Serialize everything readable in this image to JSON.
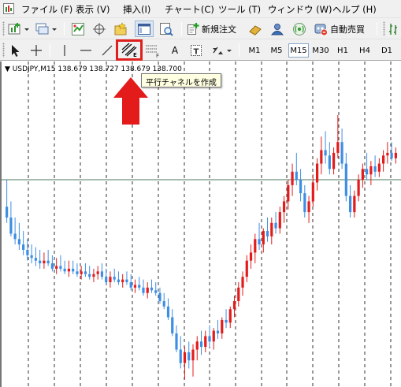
{
  "menu": {
    "items": [
      "ファイル (F)",
      "表示 (V)",
      "挿入(I)",
      "チャート(C)",
      "ツール (T)",
      "ウィンドウ (W)",
      "ヘルプ (H)"
    ]
  },
  "toolbar": {
    "new_order_label": "新規注文",
    "auto_trading_label": "自動売買"
  },
  "drawing_tools": {
    "text_label": "A",
    "text_label_tool": "T",
    "channel_tool_letter": "E",
    "fibo_letter": "F"
  },
  "timeframes": [
    "M1",
    "M5",
    "M15",
    "M30",
    "H1",
    "H4",
    "D1"
  ],
  "active_timeframe": "M15",
  "chart": {
    "header": "USDJPY,M15  138.679 138.727 138.679 138.700",
    "tooltip": "平行チャネルを作成"
  },
  "colors": {
    "bull": "#e31b1b",
    "bear": "#3e8ee3",
    "arrow": "#e31b1b",
    "grid": "#000000",
    "horizontal_line": "#4a7a5c"
  },
  "chart_data": {
    "type": "candlestick",
    "symbol": "USDJPY",
    "timeframe": "M15",
    "header_values": [
      138.679,
      138.727,
      138.679,
      138.7
    ],
    "note": "Relative price path in relative units (0 = lowest low, 100 = highest high); no price axis is visible.",
    "candles": [
      {
        "o": 66,
        "h": 76,
        "l": 60,
        "c": 62
      },
      {
        "o": 62,
        "h": 68,
        "l": 55,
        "c": 56
      },
      {
        "o": 56,
        "h": 62,
        "l": 52,
        "c": 54
      },
      {
        "o": 54,
        "h": 60,
        "l": 50,
        "c": 52
      },
      {
        "o": 52,
        "h": 57,
        "l": 48,
        "c": 50
      },
      {
        "o": 50,
        "h": 54,
        "l": 46,
        "c": 48
      },
      {
        "o": 48,
        "h": 52,
        "l": 45,
        "c": 47
      },
      {
        "o": 47,
        "h": 51,
        "l": 44,
        "c": 46
      },
      {
        "o": 46,
        "h": 50,
        "l": 43,
        "c": 45
      },
      {
        "o": 45,
        "h": 49,
        "l": 43,
        "c": 46
      },
      {
        "o": 46,
        "h": 50,
        "l": 44,
        "c": 45
      },
      {
        "o": 45,
        "h": 48,
        "l": 42,
        "c": 43
      },
      {
        "o": 43,
        "h": 47,
        "l": 41,
        "c": 44
      },
      {
        "o": 44,
        "h": 48,
        "l": 42,
        "c": 43
      },
      {
        "o": 43,
        "h": 46,
        "l": 41,
        "c": 42
      },
      {
        "o": 42,
        "h": 46,
        "l": 40,
        "c": 43
      },
      {
        "o": 43,
        "h": 46,
        "l": 41,
        "c": 42
      },
      {
        "o": 42,
        "h": 45,
        "l": 40,
        "c": 41
      },
      {
        "o": 41,
        "h": 44,
        "l": 39,
        "c": 42
      },
      {
        "o": 42,
        "h": 45,
        "l": 40,
        "c": 41
      },
      {
        "o": 41,
        "h": 44,
        "l": 39,
        "c": 40
      },
      {
        "o": 40,
        "h": 43,
        "l": 38,
        "c": 41
      },
      {
        "o": 41,
        "h": 44,
        "l": 39,
        "c": 42
      },
      {
        "o": 42,
        "h": 45,
        "l": 39,
        "c": 40
      },
      {
        "o": 40,
        "h": 43,
        "l": 37,
        "c": 38
      },
      {
        "o": 38,
        "h": 42,
        "l": 36,
        "c": 40
      },
      {
        "o": 40,
        "h": 43,
        "l": 38,
        "c": 39
      },
      {
        "o": 39,
        "h": 42,
        "l": 37,
        "c": 38
      },
      {
        "o": 38,
        "h": 41,
        "l": 36,
        "c": 39
      },
      {
        "o": 39,
        "h": 42,
        "l": 37,
        "c": 38
      },
      {
        "o": 38,
        "h": 41,
        "l": 35,
        "c": 36
      },
      {
        "o": 36,
        "h": 39,
        "l": 34,
        "c": 37
      },
      {
        "o": 37,
        "h": 40,
        "l": 35,
        "c": 36
      },
      {
        "o": 36,
        "h": 39,
        "l": 33,
        "c": 34
      },
      {
        "o": 34,
        "h": 38,
        "l": 32,
        "c": 36
      },
      {
        "o": 36,
        "h": 39,
        "l": 34,
        "c": 35
      },
      {
        "o": 35,
        "h": 38,
        "l": 33,
        "c": 34
      },
      {
        "o": 34,
        "h": 36,
        "l": 30,
        "c": 31
      },
      {
        "o": 31,
        "h": 34,
        "l": 28,
        "c": 29
      },
      {
        "o": 29,
        "h": 32,
        "l": 24,
        "c": 25
      },
      {
        "o": 25,
        "h": 28,
        "l": 18,
        "c": 19
      },
      {
        "o": 19,
        "h": 22,
        "l": 12,
        "c": 13
      },
      {
        "o": 13,
        "h": 18,
        "l": 6,
        "c": 8
      },
      {
        "o": 8,
        "h": 14,
        "l": 2,
        "c": 12
      },
      {
        "o": 12,
        "h": 16,
        "l": 6,
        "c": 9
      },
      {
        "o": 9,
        "h": 15,
        "l": 3,
        "c": 13
      },
      {
        "o": 13,
        "h": 18,
        "l": 9,
        "c": 16
      },
      {
        "o": 16,
        "h": 20,
        "l": 11,
        "c": 14
      },
      {
        "o": 14,
        "h": 20,
        "l": 12,
        "c": 18
      },
      {
        "o": 18,
        "h": 22,
        "l": 14,
        "c": 16
      },
      {
        "o": 16,
        "h": 21,
        "l": 13,
        "c": 20
      },
      {
        "o": 20,
        "h": 24,
        "l": 17,
        "c": 19
      },
      {
        "o": 19,
        "h": 25,
        "l": 17,
        "c": 24
      },
      {
        "o": 24,
        "h": 28,
        "l": 21,
        "c": 23
      },
      {
        "o": 23,
        "h": 29,
        "l": 21,
        "c": 28
      },
      {
        "o": 28,
        "h": 33,
        "l": 25,
        "c": 31
      },
      {
        "o": 31,
        "h": 38,
        "l": 29,
        "c": 36
      },
      {
        "o": 36,
        "h": 42,
        "l": 33,
        "c": 40
      },
      {
        "o": 40,
        "h": 48,
        "l": 38,
        "c": 46
      },
      {
        "o": 46,
        "h": 52,
        "l": 43,
        "c": 49
      },
      {
        "o": 49,
        "h": 56,
        "l": 45,
        "c": 54
      },
      {
        "o": 54,
        "h": 60,
        "l": 50,
        "c": 52
      },
      {
        "o": 52,
        "h": 58,
        "l": 49,
        "c": 57
      },
      {
        "o": 57,
        "h": 62,
        "l": 53,
        "c": 55
      },
      {
        "o": 55,
        "h": 62,
        "l": 52,
        "c": 60
      },
      {
        "o": 60,
        "h": 64,
        "l": 56,
        "c": 58
      },
      {
        "o": 58,
        "h": 66,
        "l": 56,
        "c": 64
      },
      {
        "o": 64,
        "h": 70,
        "l": 60,
        "c": 68
      },
      {
        "o": 68,
        "h": 76,
        "l": 65,
        "c": 74
      },
      {
        "o": 74,
        "h": 82,
        "l": 70,
        "c": 79
      },
      {
        "o": 79,
        "h": 86,
        "l": 74,
        "c": 76
      },
      {
        "o": 76,
        "h": 80,
        "l": 68,
        "c": 71
      },
      {
        "o": 71,
        "h": 74,
        "l": 62,
        "c": 64
      },
      {
        "o": 64,
        "h": 70,
        "l": 60,
        "c": 68
      },
      {
        "o": 68,
        "h": 78,
        "l": 66,
        "c": 75
      },
      {
        "o": 75,
        "h": 84,
        "l": 72,
        "c": 82
      },
      {
        "o": 82,
        "h": 92,
        "l": 78,
        "c": 87
      },
      {
        "o": 87,
        "h": 94,
        "l": 82,
        "c": 85
      },
      {
        "o": 85,
        "h": 90,
        "l": 78,
        "c": 80
      },
      {
        "o": 80,
        "h": 88,
        "l": 78,
        "c": 86
      },
      {
        "o": 86,
        "h": 100,
        "l": 84,
        "c": 90
      },
      {
        "o": 90,
        "h": 95,
        "l": 80,
        "c": 82
      },
      {
        "o": 82,
        "h": 86,
        "l": 68,
        "c": 70
      },
      {
        "o": 70,
        "h": 74,
        "l": 62,
        "c": 64
      },
      {
        "o": 64,
        "h": 72,
        "l": 62,
        "c": 70
      },
      {
        "o": 70,
        "h": 78,
        "l": 68,
        "c": 76
      },
      {
        "o": 76,
        "h": 82,
        "l": 73,
        "c": 80
      },
      {
        "o": 80,
        "h": 86,
        "l": 76,
        "c": 78
      },
      {
        "o": 78,
        "h": 83,
        "l": 74,
        "c": 81
      },
      {
        "o": 81,
        "h": 85,
        "l": 77,
        "c": 79
      },
      {
        "o": 79,
        "h": 84,
        "l": 77,
        "c": 82
      },
      {
        "o": 82,
        "h": 87,
        "l": 79,
        "c": 85
      },
      {
        "o": 85,
        "h": 90,
        "l": 82,
        "c": 86
      },
      {
        "o": 86,
        "h": 90,
        "l": 83,
        "c": 84
      },
      {
        "o": 84,
        "h": 88,
        "l": 82,
        "c": 86
      }
    ]
  }
}
